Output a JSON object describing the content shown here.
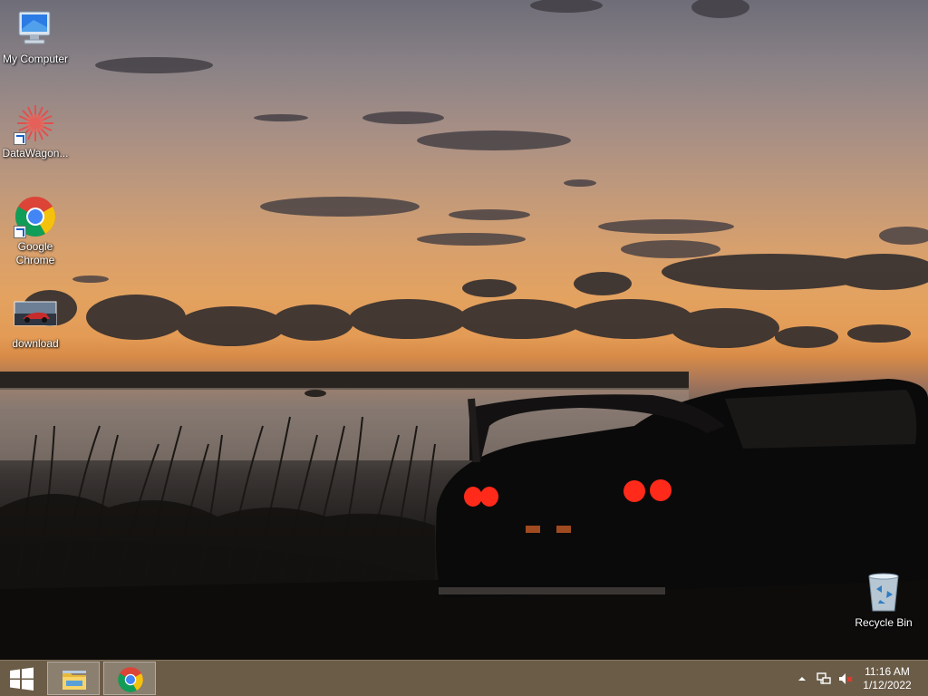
{
  "desktop": {
    "icons": [
      {
        "label": "My Computer",
        "icon": "computer-icon"
      },
      {
        "label": "DataWagon...",
        "icon": "datawagon-icon"
      },
      {
        "label": "Google Chrome",
        "icon": "chrome-icon"
      },
      {
        "label": "download",
        "icon": "image-thumbnail-icon"
      },
      {
        "label": "Recycle Bin",
        "icon": "recycle-bin-icon"
      }
    ]
  },
  "taskbar": {
    "start": {
      "icon": "windows-logo-icon"
    },
    "pinned": [
      {
        "app": "file-explorer",
        "icon": "file-explorer-icon"
      },
      {
        "app": "google-chrome",
        "icon": "chrome-icon"
      }
    ],
    "tray": {
      "icons": [
        "show-hidden-icons-chevron",
        "network-icon",
        "volume-muted-icon"
      ],
      "time": "11:16 AM",
      "date": "1/12/2022"
    }
  },
  "colors": {
    "taskbar": "#6b5c48",
    "chrome_red": "#db4437",
    "chrome_yellow": "#f4c20d",
    "chrome_green": "#0f9d58",
    "chrome_blue": "#4285f4",
    "tail_light": "#ff2a1a"
  }
}
